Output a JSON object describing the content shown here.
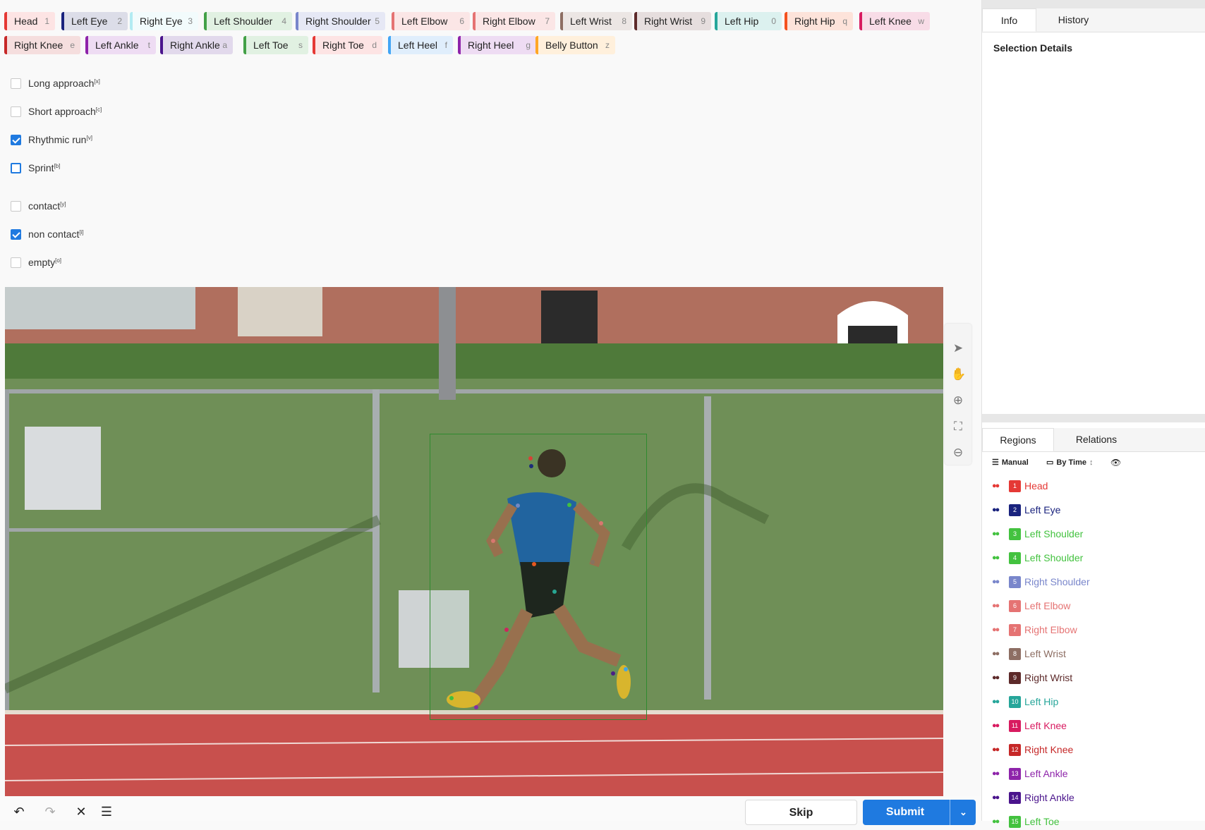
{
  "labels": [
    {
      "text": "Head",
      "key": "1",
      "color": "#e53935",
      "bg": "#fde4e4"
    },
    {
      "text": "Left Eye",
      "key": "2",
      "color": "#1a237e",
      "bg": "#dcdde8"
    },
    {
      "text": "Right Eye",
      "key": "3",
      "color": "#b2ebf2",
      "bg": "#f2fbfc"
    },
    {
      "text": "Left Shoulder",
      "key": "4",
      "color": "#43a047",
      "bg": "#e1f1e2"
    },
    {
      "text": "Right Shoulder",
      "key": "5",
      "color": "#7986cb",
      "bg": "#e6e8f5"
    },
    {
      "text": "Left Elbow",
      "key": "6",
      "color": "#e57373",
      "bg": "#fbe6e6"
    },
    {
      "text": "Right Elbow",
      "key": "7",
      "color": "#e57373",
      "bg": "#fbe6e6"
    },
    {
      "text": "Left Wrist",
      "key": "8",
      "color": "#8d6e63",
      "bg": "#ece6e4"
    },
    {
      "text": "Right Wrist",
      "key": "9",
      "color": "#5d2a2a",
      "bg": "#e6dede"
    },
    {
      "text": "Left Hip",
      "key": "0",
      "color": "#26a69a",
      "bg": "#dcf1ef"
    },
    {
      "text": "Right Hip",
      "key": "q",
      "color": "#f4511e",
      "bg": "#fde3da"
    },
    {
      "text": "Left Knee",
      "key": "w",
      "color": "#d81b60",
      "bg": "#f8dce7"
    },
    {
      "text": "Right Knee",
      "key": "e",
      "color": "#c62828",
      "bg": "#f5dede"
    },
    {
      "text": "Left Ankle",
      "key": "t",
      "color": "#8e24aa",
      "bg": "#eedcf3"
    },
    {
      "text": "Right Ankle",
      "key": "a",
      "color": "#4a148c",
      "bg": "#e2d9ec"
    },
    {
      "text": "Left Toe",
      "key": "s",
      "color": "#43a047",
      "bg": "#e1f1e2"
    },
    {
      "text": "Right Toe",
      "key": "d",
      "color": "#e53935",
      "bg": "#fde4e4"
    },
    {
      "text": "Left Heel",
      "key": "f",
      "color": "#42a5f5",
      "bg": "#e0eefc"
    },
    {
      "text": "Right Heel",
      "key": "g",
      "color": "#8e24aa",
      "bg": "#eedcf3"
    },
    {
      "text": "Belly Button",
      "key": "z",
      "color": "#ffa726",
      "bg": "#fff0dc"
    }
  ],
  "choices": [
    {
      "text": "Long approach",
      "hint": "[x]",
      "checked": false
    },
    {
      "text": "Short approach",
      "hint": "[c]",
      "checked": false
    },
    {
      "text": "Rhythmic run",
      "hint": "[v]",
      "checked": true
    },
    {
      "text": "Sprint",
      "hint": "[b]",
      "checked": false
    },
    {
      "text": "contact",
      "hint": "[y]",
      "checked": false
    },
    {
      "text": "non contact",
      "hint": "[i]",
      "checked": true
    },
    {
      "text": "empty",
      "hint": "[o]",
      "checked": false
    }
  ],
  "zoom_tools": [
    {
      "icon": "pointer-icon",
      "glyph": "➤"
    },
    {
      "icon": "hand-icon",
      "glyph": "✋"
    },
    {
      "icon": "zoom-in-icon",
      "glyph": "⊕"
    },
    {
      "icon": "fit-to-screen-icon",
      "glyph": "⛶"
    },
    {
      "icon": "zoom-out-icon",
      "glyph": "⊖"
    }
  ],
  "bottom": {
    "undo_icon": "↶",
    "redo_icon": "↷",
    "reset_icon": "✕",
    "settings_icon": "☰",
    "skip_label": "Skip",
    "submit_label": "Submit",
    "submit_caret": "⌄"
  },
  "info_panel": {
    "tabs": [
      "Info",
      "History"
    ],
    "active_tab": "Info",
    "heading": "Selection Details"
  },
  "regions_panel": {
    "tabs": [
      "Regions",
      "Relations"
    ],
    "active_tab": "Regions",
    "sort_label": "Manual",
    "order_label": "By Time",
    "items": [
      {
        "n": "1",
        "text": "Head",
        "color": "#e53935"
      },
      {
        "n": "2",
        "text": "Left Eye",
        "color": "#1a237e"
      },
      {
        "n": "3",
        "text": "Left Shoulder",
        "color": "#43c23f"
      },
      {
        "n": "4",
        "text": "Left Shoulder",
        "color": "#43c23f"
      },
      {
        "n": "5",
        "text": "Right Shoulder",
        "color": "#7986cb"
      },
      {
        "n": "6",
        "text": "Left Elbow",
        "color": "#e57373"
      },
      {
        "n": "7",
        "text": "Right Elbow",
        "color": "#e57373"
      },
      {
        "n": "8",
        "text": "Left Wrist",
        "color": "#8d6e63"
      },
      {
        "n": "9",
        "text": "Right Wrist",
        "color": "#5d2a2a"
      },
      {
        "n": "10",
        "text": "Left Hip",
        "color": "#26a69a"
      },
      {
        "n": "11",
        "text": "Left Knee",
        "color": "#d81b60"
      },
      {
        "n": "12",
        "text": "Right Knee",
        "color": "#c62828"
      },
      {
        "n": "13",
        "text": "Left Ankle",
        "color": "#8e24aa"
      },
      {
        "n": "14",
        "text": "Right Ankle",
        "color": "#4a148c"
      },
      {
        "n": "15",
        "text": "Left Toe",
        "color": "#43c23f"
      }
    ]
  }
}
